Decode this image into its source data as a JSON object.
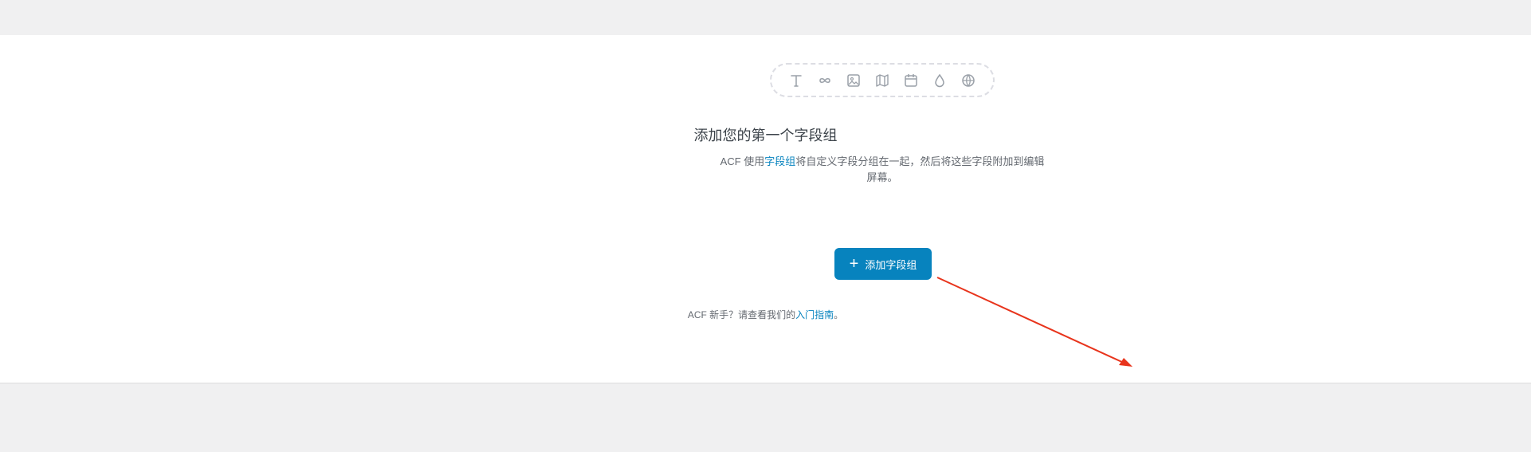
{
  "empty_state": {
    "title": "添加您的第一个字段组",
    "desc_prefix": "ACF 使用",
    "desc_link": "字段组",
    "desc_suffix": "将自定义字段分组在一起，然后将这些字段附加到编辑屏幕。",
    "add_button_label": "添加字段组",
    "help_prefix": "ACF 新手？请查看我们的",
    "help_link": "入门指南",
    "help_suffix": "。"
  },
  "field_type_icons": [
    "text-icon",
    "infinity-icon",
    "image-icon",
    "map-icon",
    "calendar-icon",
    "color-drop-icon",
    "globe-icon"
  ],
  "colors": {
    "accent": "#0783be",
    "annotation_arrow": "#e8341c",
    "icon_gray": "#9aa0a8"
  }
}
